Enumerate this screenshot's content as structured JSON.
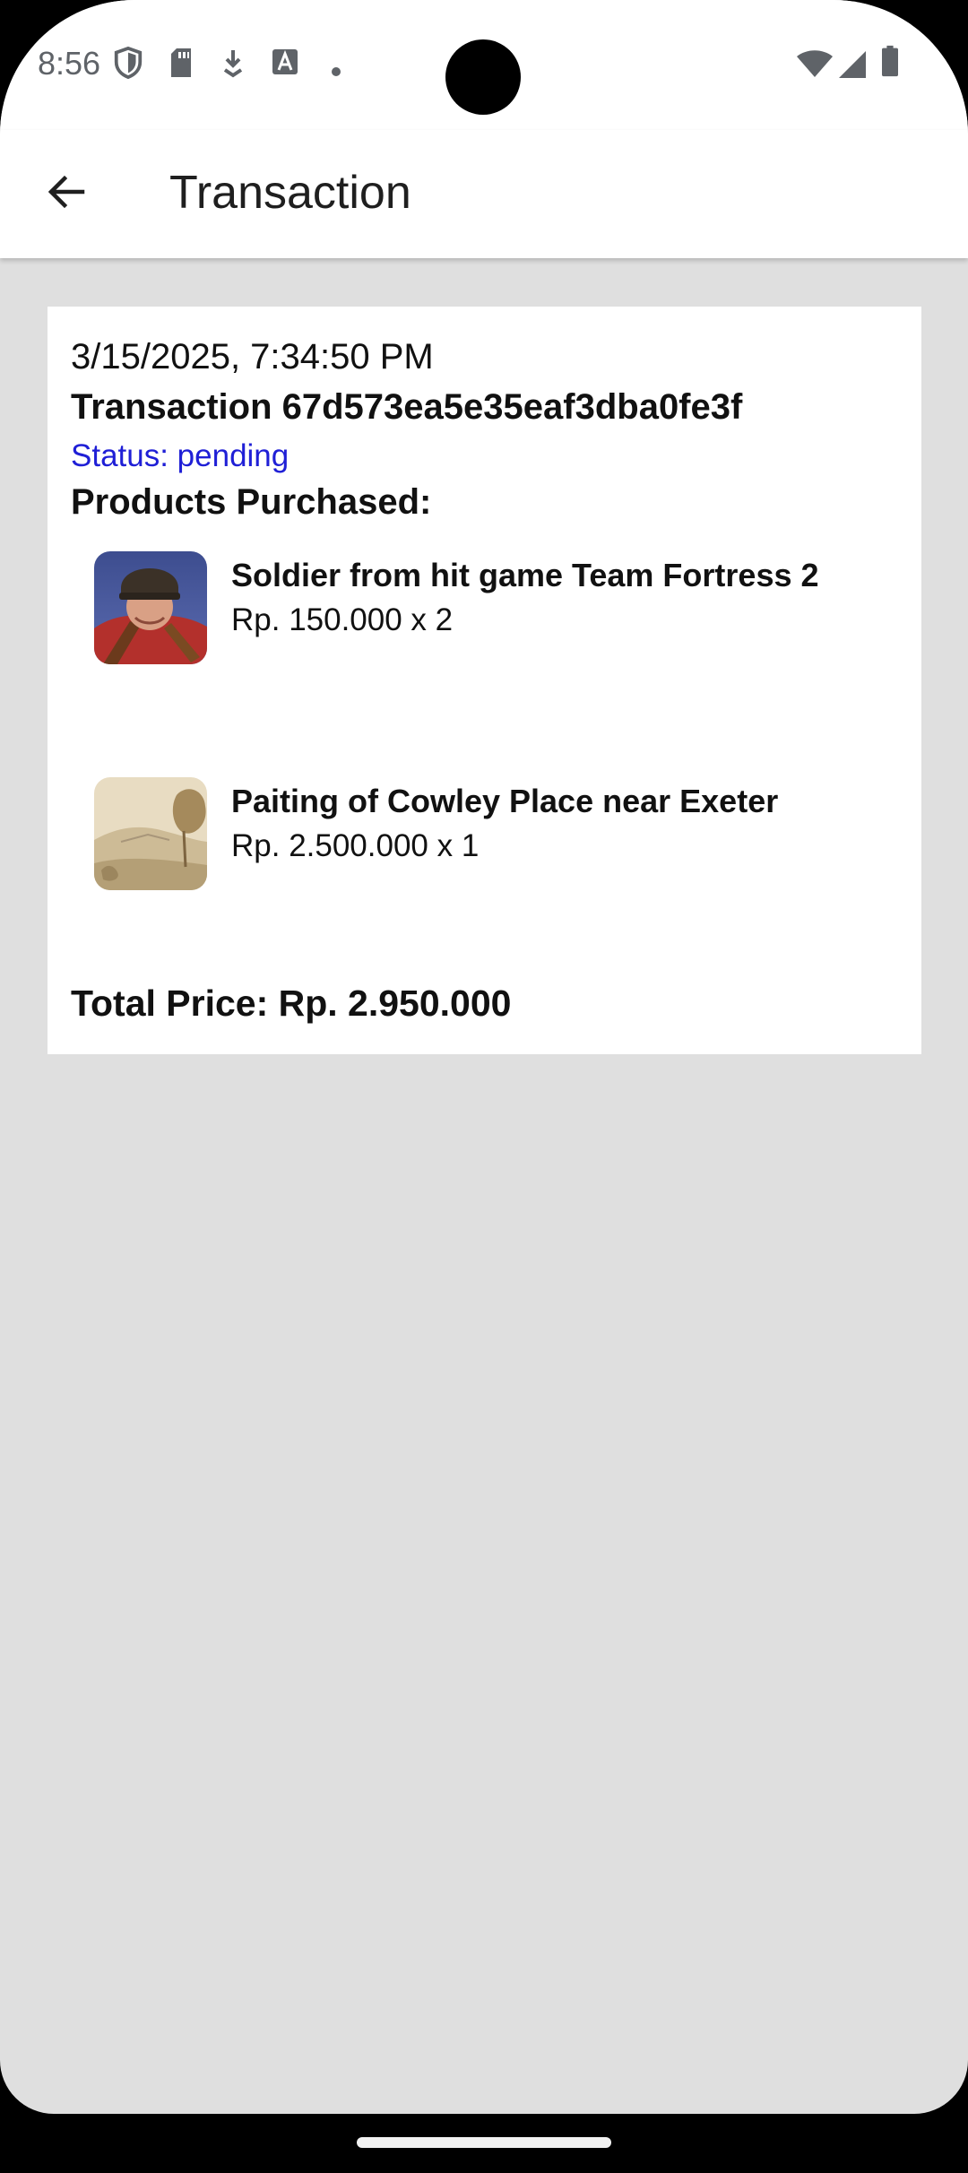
{
  "status_bar": {
    "time": "8:56",
    "left_icons": [
      "shield-icon",
      "sd-card-icon",
      "download-icon",
      "font-a-icon",
      "dot-icon"
    ],
    "right_icons": [
      "wifi-icon",
      "cellular-signal-icon",
      "battery-icon"
    ]
  },
  "app_bar": {
    "title": "Transaction",
    "back_icon": "arrow-back-icon"
  },
  "transaction": {
    "date": "3/15/2025, 7:34:50 PM",
    "id_label": "Transaction 67d573ea5e35eaf3dba0fe3f",
    "status_label": "Status: pending",
    "products_heading": "Products Purchased:",
    "products": [
      {
        "name": "Soldier from hit game Team Fortress 2",
        "price_qty": "Rp. 150.000 x 2",
        "thumbnail": "soldier-portrait-image"
      },
      {
        "name": "Paiting of Cowley Place near Exeter",
        "price_qty": "Rp. 2.500.000 x 1",
        "thumbnail": "landscape-painting-image"
      }
    ],
    "total_label": "Total Price: Rp. 2.950.000"
  },
  "colors": {
    "background": "#dfdfdf",
    "card": "#ffffff",
    "status": "#1f1fd6",
    "text": "#111111"
  }
}
